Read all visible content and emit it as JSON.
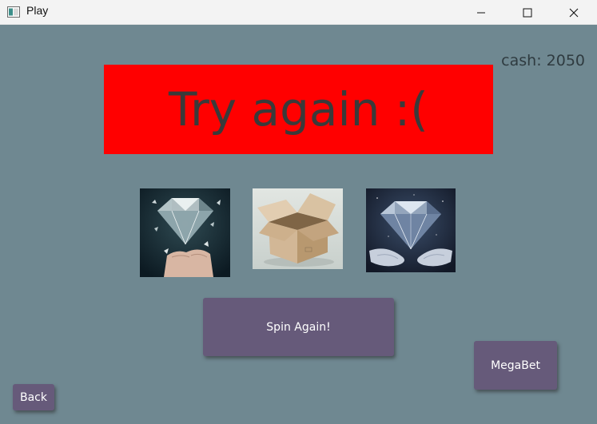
{
  "window": {
    "title": "Play",
    "controls": {
      "minimize_icon": "minimize-icon",
      "maximize_icon": "maximize-icon",
      "close_icon": "close-icon"
    }
  },
  "status": {
    "cash": "cash: 2050"
  },
  "result": {
    "message": "Try again :(",
    "banner_color": "#ff0000"
  },
  "slots": [
    {
      "icon": "shattered-diamond-in-hand-image"
    },
    {
      "icon": "empty-cardboard-box-image"
    },
    {
      "icon": "diamond-over-hands-image"
    }
  ],
  "buttons": {
    "spin": "Spin Again!",
    "megabet": "MegaBet",
    "back": "Back"
  },
  "colors": {
    "background": "#6f8891",
    "button": "#665a7a"
  }
}
